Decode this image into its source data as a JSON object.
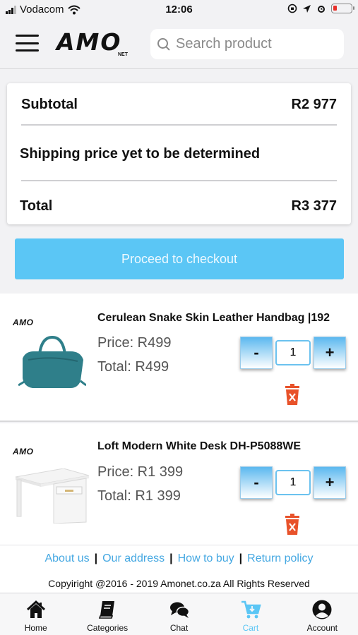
{
  "status_bar": {
    "carrier": "Vodacom",
    "time": "12:06"
  },
  "header": {
    "logo_text": "AMO",
    "logo_sub": "NET",
    "search_placeholder": "Search product"
  },
  "summary": {
    "subtotal_label": "Subtotal",
    "subtotal_value": "R2 977",
    "shipping_text": "Shipping price yet to be determined",
    "total_label": "Total",
    "total_value": "R3 377"
  },
  "checkout_label": "Proceed to checkout",
  "items": [
    {
      "brand": "AMO",
      "name": "Cerulean Snake Skin Leather Handbag |192",
      "price": "Price: R499",
      "total": "Total: R499",
      "qty": "1"
    },
    {
      "brand": "AMO",
      "name": "Loft Modern White Desk DH-P5088WE",
      "price": "Price: R1 399",
      "total": "Total: R1 399",
      "qty": "1"
    }
  ],
  "quantity_buttons": {
    "minus": "-",
    "plus": "+"
  },
  "footer": {
    "links": [
      "About us",
      "Our address",
      "How to buy",
      "Return policy"
    ],
    "separator": "|",
    "copyright": "Copyiright @2016 - 2019 Amonet.co.za All Rights Reserved"
  },
  "tabs": [
    {
      "label": "Home",
      "icon": "home-icon"
    },
    {
      "label": "Categories",
      "icon": "book-icon"
    },
    {
      "label": "Chat",
      "icon": "chat-icon"
    },
    {
      "label": "Cart",
      "icon": "cart-icon",
      "active": true
    },
    {
      "label": "Account",
      "icon": "account-icon"
    }
  ],
  "colors": {
    "accent": "#5bc6f5",
    "link": "#45a8e2",
    "delete": "#e8522a",
    "bag": "#2f7f8a"
  }
}
